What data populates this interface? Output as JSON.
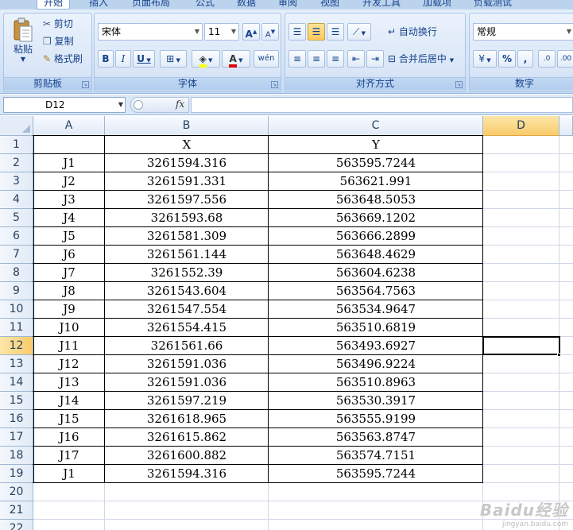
{
  "ribbon": {
    "tabs": [
      "开始",
      "插入",
      "页面布局",
      "公式",
      "数据",
      "审阅",
      "视图",
      "开发工具",
      "加载项",
      "负载测试"
    ],
    "clipboard": {
      "paste": "粘贴",
      "cut": "剪切",
      "copy": "复制",
      "format_painter": "格式刷",
      "label": "剪贴板"
    },
    "font": {
      "name": "宋体",
      "size": "11",
      "bold": "B",
      "italic": "I",
      "underline": "U",
      "grow": "A",
      "shrink": "A",
      "color_letter": "A",
      "phonetic": "wén",
      "label": "字体"
    },
    "alignment": {
      "wrap": "自动换行",
      "merge": "合并后居中",
      "label": "对齐方式"
    },
    "number": {
      "format": "常规",
      "percent": "%",
      "comma": ",",
      "label": "数字"
    }
  },
  "formula_bar": {
    "name_box": "D12",
    "fx": "fx",
    "formula": ""
  },
  "grid": {
    "columns": [
      "A",
      "B",
      "C",
      "D"
    ],
    "rows": [
      "1",
      "2",
      "3",
      "4",
      "5",
      "6",
      "7",
      "8",
      "9",
      "10",
      "11",
      "12",
      "13",
      "14",
      "15",
      "16",
      "17",
      "18",
      "19",
      "20",
      "21",
      "22"
    ],
    "header_row": [
      "",
      "X",
      "Y"
    ],
    "data": [
      [
        "J1",
        "3261594.316",
        "563595.7244"
      ],
      [
        "J2",
        "3261591.331",
        "563621.991"
      ],
      [
        "J3",
        "3261597.556",
        "563648.5053"
      ],
      [
        "J4",
        "3261593.68",
        "563669.1202"
      ],
      [
        "J5",
        "3261581.309",
        "563666.2899"
      ],
      [
        "J6",
        "3261561.144",
        "563648.4629"
      ],
      [
        "J7",
        "3261552.39",
        "563604.6238"
      ],
      [
        "J8",
        "3261543.604",
        "563564.7563"
      ],
      [
        "J9",
        "3261547.554",
        "563534.9647"
      ],
      [
        "J10",
        "3261554.415",
        "563510.6819"
      ],
      [
        "J11",
        "3261561.66",
        "563493.6927"
      ],
      [
        "J12",
        "3261591.036",
        "563496.9224"
      ],
      [
        "J13",
        "3261591.036",
        "563510.8963"
      ],
      [
        "J14",
        "3261597.219",
        "563530.3917"
      ],
      [
        "J15",
        "3261618.965",
        "563555.9199"
      ],
      [
        "J16",
        "3261615.862",
        "563563.8747"
      ],
      [
        "J17",
        "3261600.882",
        "563574.7151"
      ],
      [
        "J1",
        "3261594.316",
        "563595.7244"
      ]
    ],
    "selected_cell": "D12"
  },
  "watermark": {
    "logo": "Baidu经验",
    "url": "jingyan.baidu.com"
  }
}
